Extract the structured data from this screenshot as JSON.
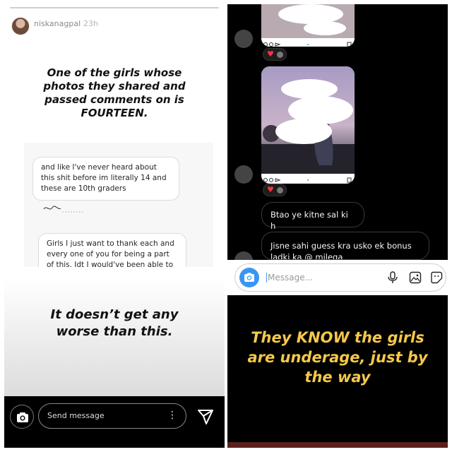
{
  "left_story": {
    "username": "niskanagpal",
    "time_ago": "23h",
    "headline": "One of the girls whose photos they shared and passed comments on is FOURTEEN.",
    "screenshot_messages": [
      "and like I've never heard about this shit before im literally 14 and these are 10th graders",
      "Girls I just want to thank each and every one of you for being a part of this. Idt I would've been able to move"
    ],
    "bottom_text": "It doesn’t get any worse than this.",
    "reply_placeholder": "Send message",
    "more_icon": "⋮"
  },
  "right_dm": {
    "messages": [
      "Btao ye kitne sal ki h",
      "Jisne sahi guess kra usko ek bonus ladki ka @ milega"
    ],
    "composer_placeholder": "Message...",
    "caption": "They KNOW the girls are underage, just by the way"
  },
  "icons": [
    "camera-icon",
    "send-icon",
    "more-icon",
    "heart-icon",
    "microphone-icon",
    "gallery-icon",
    "sticker-icon"
  ],
  "colors": {
    "caption": "#f5c84a",
    "camera_blue": "#3897f0",
    "heart": "#ff3040"
  }
}
